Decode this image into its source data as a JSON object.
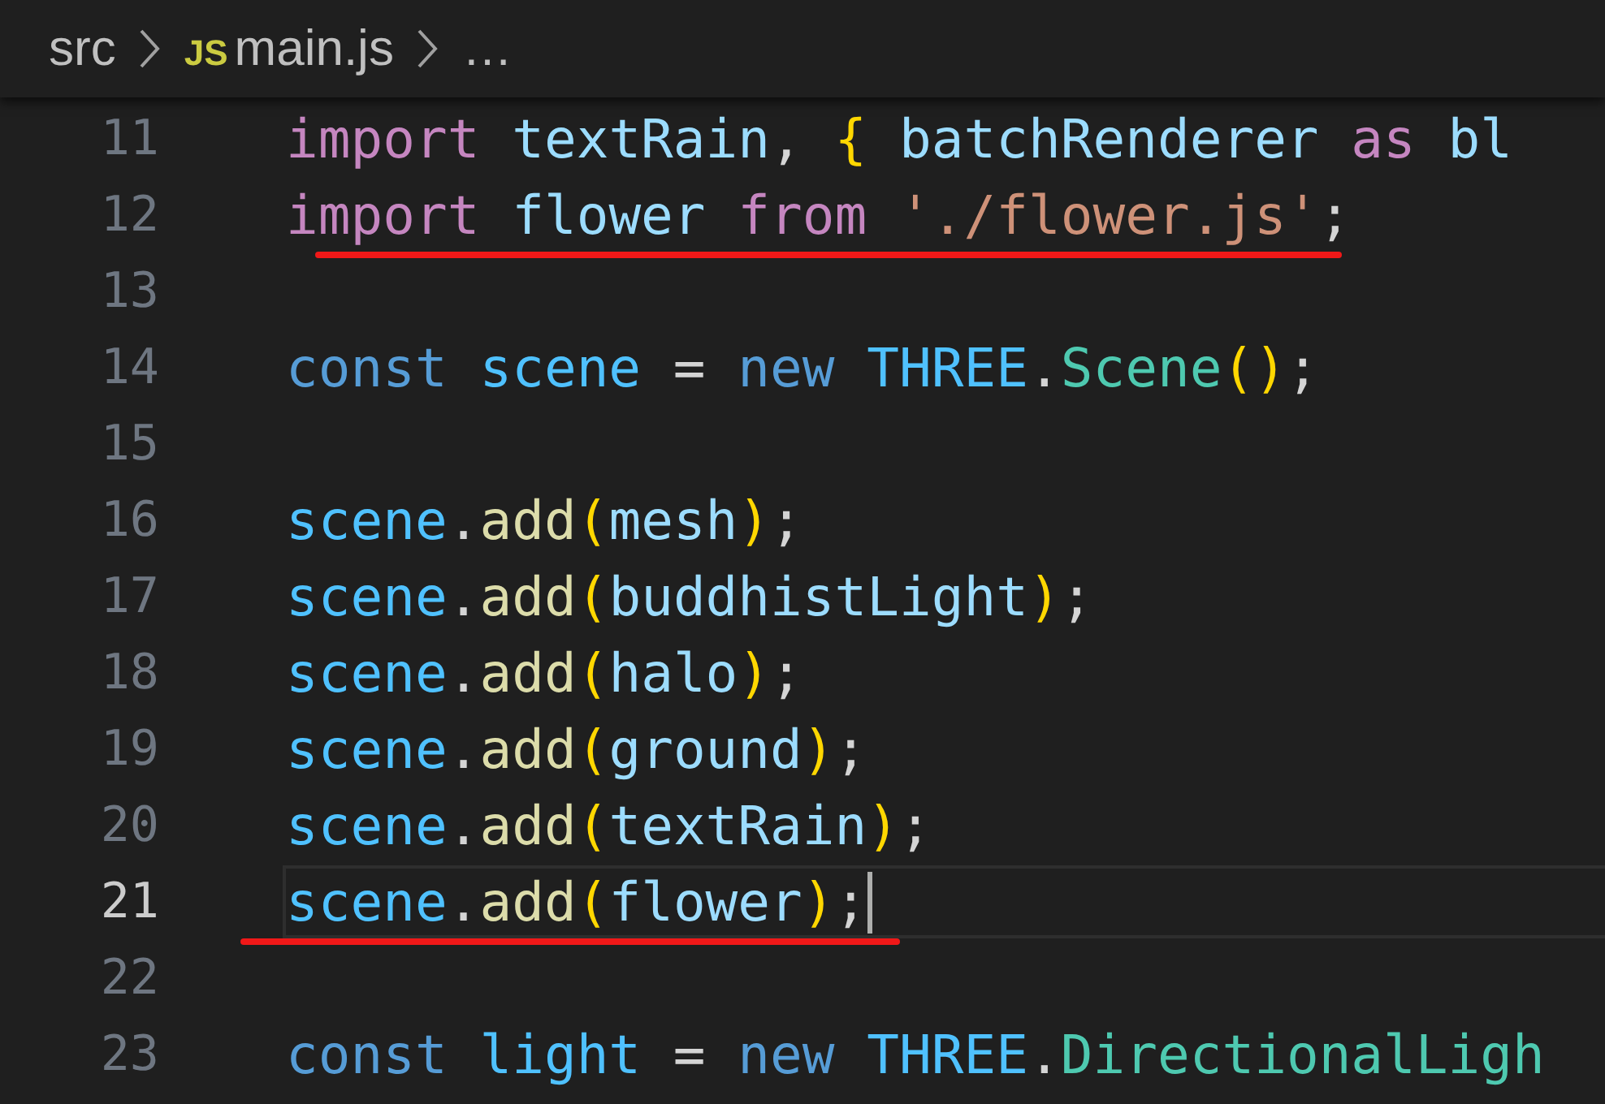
{
  "breadcrumb": [
    {
      "label": "src"
    },
    {
      "badge": "JS",
      "label": "main.js"
    },
    {
      "label": "…"
    }
  ],
  "lines": [
    {
      "number": "11",
      "current": false,
      "underlined": false,
      "tokens": [
        {
          "kind": "keyword",
          "text": "import"
        },
        {
          "kind": "variable",
          "text": " textRain"
        },
        {
          "kind": "plain",
          "text": ", "
        },
        {
          "kind": "bracket",
          "text": "{"
        },
        {
          "kind": "variable",
          "text": " batchRenderer"
        },
        {
          "kind": "keyword",
          "text": " as"
        },
        {
          "kind": "variable",
          "text": " bl"
        }
      ]
    },
    {
      "number": "12",
      "current": false,
      "underlined": true,
      "tokens": [
        {
          "kind": "keyword",
          "text": "import"
        },
        {
          "kind": "variable",
          "text": " flower"
        },
        {
          "kind": "keyword",
          "text": " from"
        },
        {
          "kind": "string",
          "text": " './flower.js'"
        },
        {
          "kind": "plain",
          "text": ";"
        }
      ]
    },
    {
      "number": "13",
      "current": false,
      "underlined": false
    },
    {
      "number": "14",
      "current": false,
      "underlined": false,
      "tokens": [
        {
          "kind": "storage",
          "text": "const"
        },
        {
          "kind": "constant",
          "text": " scene"
        },
        {
          "kind": "plain",
          "text": " = "
        },
        {
          "kind": "storage",
          "text": "new"
        },
        {
          "kind": "constant",
          "text": " THREE"
        },
        {
          "kind": "plain",
          "text": "."
        },
        {
          "kind": "class",
          "text": "Scene"
        },
        {
          "kind": "bracket",
          "text": "()"
        },
        {
          "kind": "plain",
          "text": ";"
        }
      ]
    },
    {
      "number": "15",
      "current": false,
      "underlined": false
    },
    {
      "number": "16",
      "current": false,
      "underlined": false,
      "tokens": [
        {
          "kind": "constant",
          "text": "scene"
        },
        {
          "kind": "plain",
          "text": "."
        },
        {
          "kind": "function",
          "text": "add"
        },
        {
          "kind": "bracket",
          "text": "("
        },
        {
          "kind": "variable",
          "text": "mesh"
        },
        {
          "kind": "bracket",
          "text": ")"
        },
        {
          "kind": "plain",
          "text": ";"
        }
      ]
    },
    {
      "number": "17",
      "current": false,
      "underlined": false,
      "tokens": [
        {
          "kind": "constant",
          "text": "scene"
        },
        {
          "kind": "plain",
          "text": "."
        },
        {
          "kind": "function",
          "text": "add"
        },
        {
          "kind": "bracket",
          "text": "("
        },
        {
          "kind": "variable",
          "text": "buddhistLight"
        },
        {
          "kind": "bracket",
          "text": ")"
        },
        {
          "kind": "plain",
          "text": ";"
        }
      ]
    },
    {
      "number": "18",
      "current": false,
      "underlined": false,
      "tokens": [
        {
          "kind": "constant",
          "text": "scene"
        },
        {
          "kind": "plain",
          "text": "."
        },
        {
          "kind": "function",
          "text": "add"
        },
        {
          "kind": "bracket",
          "text": "("
        },
        {
          "kind": "variable",
          "text": "halo"
        },
        {
          "kind": "bracket",
          "text": ")"
        },
        {
          "kind": "plain",
          "text": ";"
        }
      ]
    },
    {
      "number": "19",
      "current": false,
      "underlined": false,
      "tokens": [
        {
          "kind": "constant",
          "text": "scene"
        },
        {
          "kind": "plain",
          "text": "."
        },
        {
          "kind": "function",
          "text": "add"
        },
        {
          "kind": "bracket",
          "text": "("
        },
        {
          "kind": "variable",
          "text": "ground"
        },
        {
          "kind": "bracket",
          "text": ")"
        },
        {
          "kind": "plain",
          "text": ";"
        }
      ]
    },
    {
      "number": "20",
      "current": false,
      "underlined": false,
      "tokens": [
        {
          "kind": "constant",
          "text": "scene"
        },
        {
          "kind": "plain",
          "text": "."
        },
        {
          "kind": "function",
          "text": "add"
        },
        {
          "kind": "bracket",
          "text": "("
        },
        {
          "kind": "variable",
          "text": "textRain"
        },
        {
          "kind": "bracket",
          "text": ")"
        },
        {
          "kind": "plain",
          "text": ";"
        }
      ]
    },
    {
      "number": "21",
      "current": true,
      "underlined": true,
      "tokens": [
        {
          "kind": "constant",
          "text": "scene"
        },
        {
          "kind": "plain",
          "text": "."
        },
        {
          "kind": "function",
          "text": "add"
        },
        {
          "kind": "bracket",
          "text": "("
        },
        {
          "kind": "variable",
          "text": "flower"
        },
        {
          "kind": "bracket",
          "text": ")"
        },
        {
          "kind": "plain",
          "text": ";"
        }
      ]
    },
    {
      "number": "22",
      "current": false,
      "underlined": false
    },
    {
      "number": "23",
      "current": false,
      "underlined": false,
      "tokens": [
        {
          "kind": "storage",
          "text": "const"
        },
        {
          "kind": "constant",
          "text": " light"
        },
        {
          "kind": "plain",
          "text": " = "
        },
        {
          "kind": "storage",
          "text": "new"
        },
        {
          "kind": "constant",
          "text": " THREE"
        },
        {
          "kind": "plain",
          "text": "."
        },
        {
          "kind": "class",
          "text": "DirectionalLigh"
        }
      ]
    }
  ]
}
